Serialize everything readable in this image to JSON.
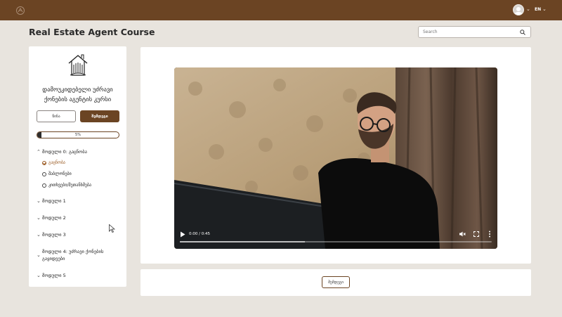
{
  "header": {
    "language": "EN"
  },
  "page": {
    "title": "Real Estate Agent Course"
  },
  "search": {
    "placeholder": "Search"
  },
  "sidebar": {
    "course_title_line1": "დამოუკიდებელი უძრავი",
    "course_title_line2": "ქონების აგენტის კურსი",
    "prev_label": "წინა",
    "next_label": "შემდეგი",
    "progress": {
      "percent": 5,
      "label": "5%"
    },
    "modules": [
      {
        "label": "მოდული 0: გაცნობა",
        "expanded": true,
        "lessons": [
          {
            "label": "გაცნობა",
            "status": "active"
          },
          {
            "label": "შაბლონები",
            "status": "not-started"
          },
          {
            "label": "კითხვები/შეთანხმება",
            "status": "not-started"
          }
        ]
      },
      {
        "label": "მოდული 1",
        "expanded": false
      },
      {
        "label": "მოდული 2",
        "expanded": false
      },
      {
        "label": "მოდული 3",
        "expanded": false
      },
      {
        "label_line1": "მოდული 4: უძრავი ქონების",
        "label_line2": "გაყიდვები",
        "expanded": false
      },
      {
        "label": "მოდული 5",
        "expanded": false
      }
    ]
  },
  "video": {
    "time": "0:00 / 0:45",
    "progress_fraction": 0.0,
    "buffered_fraction": 0.4
  },
  "footer": {
    "next_label": "შემდეგი"
  },
  "icons": {
    "brand": "brand-logo-icon",
    "search": "search-icon",
    "course": "house-logo-icon"
  },
  "colors": {
    "brand": "#6b4423",
    "background": "#e8e4de",
    "active_lesson": "#9a5a22"
  }
}
